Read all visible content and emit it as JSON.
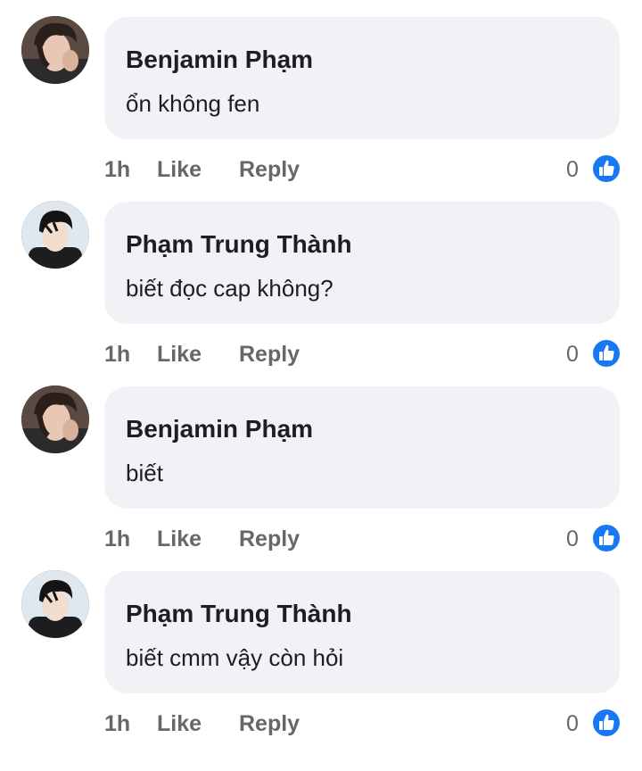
{
  "colors": {
    "bubble": "#f0f2f5",
    "text": "#1c1e21",
    "meta": "#65676b",
    "like_blue": "#1877f2"
  },
  "icons": {
    "reaction": "like-thumb-icon"
  },
  "comments": [
    {
      "author": "Benjamin Phạm",
      "text": "ổn không fen",
      "time": "1h",
      "like_label": "Like",
      "reply_label": "Reply",
      "reaction_count": "0"
    },
    {
      "author": "Phạm Trung Thành",
      "text": "biết đọc cap không?",
      "time": "1h",
      "like_label": "Like",
      "reply_label": "Reply",
      "reaction_count": "0"
    },
    {
      "author": "Benjamin Phạm",
      "text": "biết",
      "time": "1h",
      "like_label": "Like",
      "reply_label": "Reply",
      "reaction_count": "0"
    },
    {
      "author": "Phạm Trung Thành",
      "text": "biết cmm vậy còn hỏi",
      "time": "1h",
      "like_label": "Like",
      "reply_label": "Reply",
      "reaction_count": "0"
    }
  ]
}
